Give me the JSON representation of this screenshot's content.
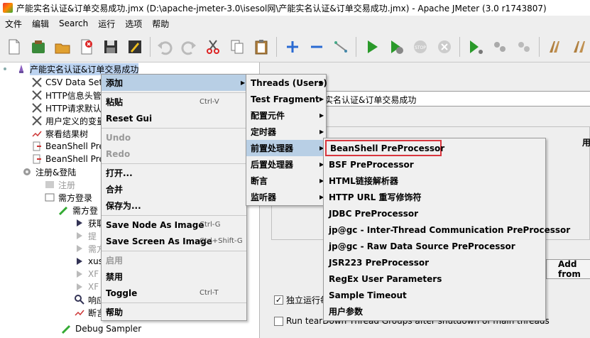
{
  "window": {
    "title": "产能实名认证&订单交易成功.jmx (D:\\apache-jmeter-3.0\\isesol网\\产能实名认证&订单交易成功.jmx) - Apache JMeter (3.0 r1743807)"
  },
  "menubar": {
    "items": [
      "文件",
      "编辑",
      "Search",
      "运行",
      "选项",
      "帮助"
    ]
  },
  "tree": {
    "root": "产能实名认证&订单交易成功",
    "nodes": [
      "CSV Data Set",
      "HTTP信息头管",
      "HTTP请求默认",
      "用户定义的变量",
      "察看结果树",
      "BeanShell Pre",
      "BeanShell Pre",
      "注册&登陆",
      "注册",
      "需方登录",
      "需方登",
      "获取",
      "提",
      "需方",
      "xus",
      "XF",
      "XF",
      "响应",
      "断言结果",
      "Debug Sampler"
    ]
  },
  "right": {
    "field_value": "实名认证&订单交易成功",
    "right_edge_label": "用",
    "add_button": "Add from",
    "checkbox1": "独立运行每",
    "checkbox2": "Run tearDown Thread Groups after shutdown of main threads"
  },
  "context_menu": {
    "items": [
      {
        "label": "添加",
        "shortcut": "",
        "submenu": true,
        "disabled": false,
        "highlighted": true
      },
      {
        "label": "粘贴",
        "shortcut": "Ctrl-V",
        "submenu": false,
        "disabled": false
      },
      {
        "label": "Reset Gui",
        "shortcut": "",
        "submenu": false,
        "disabled": false
      },
      {
        "label": "Undo",
        "shortcut": "",
        "submenu": false,
        "disabled": true
      },
      {
        "label": "Redo",
        "shortcut": "",
        "submenu": false,
        "disabled": true
      },
      {
        "label": "打开...",
        "shortcut": "",
        "submenu": false,
        "disabled": false
      },
      {
        "label": "合并",
        "shortcut": "",
        "submenu": false,
        "disabled": false
      },
      {
        "label": "保存为...",
        "shortcut": "",
        "submenu": false,
        "disabled": false
      },
      {
        "label": "Save Node As Image",
        "shortcut": "Ctrl-G",
        "submenu": false,
        "disabled": false
      },
      {
        "label": "Save Screen As Image",
        "shortcut": "Ctrl+Shift-G",
        "submenu": false,
        "disabled": false
      },
      {
        "label": "启用",
        "shortcut": "",
        "submenu": false,
        "disabled": true
      },
      {
        "label": "禁用",
        "shortcut": "",
        "submenu": false,
        "disabled": false
      },
      {
        "label": "Toggle",
        "shortcut": "Ctrl-T",
        "submenu": false,
        "disabled": false
      },
      {
        "label": "帮助",
        "shortcut": "",
        "submenu": false,
        "disabled": false
      }
    ]
  },
  "add_submenu": {
    "items": [
      {
        "label": "Threads (Users)",
        "highlighted": false
      },
      {
        "label": "Test Fragment",
        "highlighted": false
      },
      {
        "label": "配置元件",
        "highlighted": false
      },
      {
        "label": "定时器",
        "highlighted": false
      },
      {
        "label": "前置处理器",
        "highlighted": true
      },
      {
        "label": "后置处理器",
        "highlighted": false
      },
      {
        "label": "断言",
        "highlighted": false
      },
      {
        "label": "监听器",
        "highlighted": false
      }
    ]
  },
  "preprocessor_submenu": {
    "items": [
      "BeanShell PreProcessor",
      "BSF PreProcessor",
      "HTML链接解析器",
      "HTTP URL 重写修饰符",
      "JDBC PreProcessor",
      "jp@gc - Inter-Thread Communication PreProcessor",
      "jp@gc - Raw Data Source PreProcessor",
      "JSR223 PreProcessor",
      "RegEx User Parameters",
      "Sample Timeout",
      "用户参数"
    ],
    "outlined_item": "BeanShell PreProcessor",
    "outline_color": "#d9363e"
  }
}
